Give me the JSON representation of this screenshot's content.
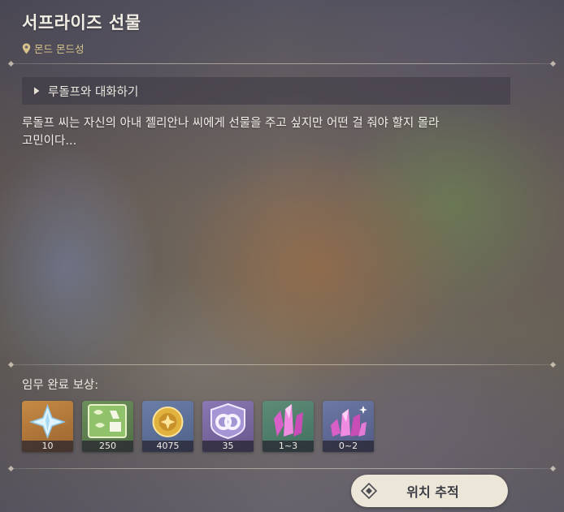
{
  "quest": {
    "title": "서프라이즈 선물",
    "location": "몬드 몬드성",
    "objective": "루돌프와 대화하기",
    "description_lines": [
      "루돌프 씨는 자신의 아내 젤리안나 씨에게 선물을 주고 싶지만 어떤 걸 줘야 할지 몰라",
      "고민이다..."
    ]
  },
  "rewards": {
    "label": "임무 완료 보상:",
    "items": [
      {
        "icon": "primogem-icon",
        "count": "10"
      },
      {
        "icon": "adventure-exp-icon",
        "count": "250"
      },
      {
        "icon": "mora-icon",
        "count": "4075"
      },
      {
        "icon": "companionship-exp-icon",
        "count": "35"
      },
      {
        "icon": "crystal-chunk-icon",
        "count": "1~3"
      },
      {
        "icon": "crystal-cluster-icon",
        "count": "0~2"
      }
    ]
  },
  "actions": {
    "track_label": "위치 추적"
  },
  "colors": {
    "location_gold": "#d8c48b",
    "button_bg": "#ece6d9"
  }
}
